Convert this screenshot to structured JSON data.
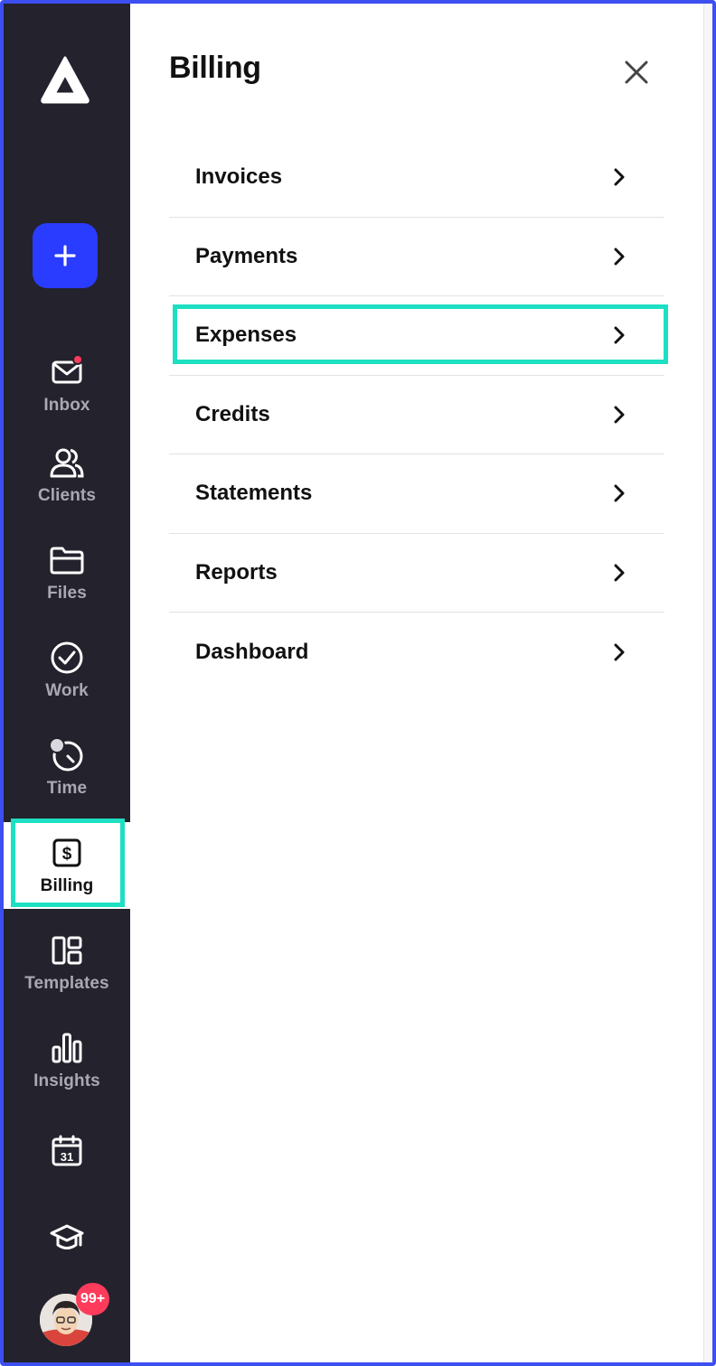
{
  "sidebar": {
    "logo_icon": "app-logo-triangle",
    "add_icon": "plus-icon",
    "items": [
      {
        "id": "inbox",
        "label": "Inbox",
        "icon": "mail-icon",
        "has_dot": true
      },
      {
        "id": "clients",
        "label": "Clients",
        "icon": "users-icon"
      },
      {
        "id": "files",
        "label": "Files",
        "icon": "folder-icon"
      },
      {
        "id": "work",
        "label": "Work",
        "icon": "check-circle-icon"
      },
      {
        "id": "time",
        "label": "Time",
        "icon": "timer-icon"
      },
      {
        "id": "billing",
        "label": "Billing",
        "icon": "dollar-icon",
        "active": true
      },
      {
        "id": "templates",
        "label": "Templates",
        "icon": "layout-icon"
      },
      {
        "id": "insights",
        "label": "Insights",
        "icon": "bar-chart-icon"
      },
      {
        "id": "calendar",
        "label": "",
        "icon": "calendar-icon",
        "icon_text": "31"
      },
      {
        "id": "academy",
        "label": "",
        "icon": "graduation-cap-icon"
      }
    ],
    "avatar_badge": "99+"
  },
  "panel": {
    "title": "Billing",
    "close_icon": "close-icon",
    "menu": [
      {
        "label": "Invoices"
      },
      {
        "label": "Payments"
      },
      {
        "label": "Expenses",
        "highlighted": true
      },
      {
        "label": "Credits"
      },
      {
        "label": "Statements"
      },
      {
        "label": "Reports"
      },
      {
        "label": "Dashboard"
      }
    ]
  },
  "colors": {
    "sidebar_bg": "#23222d",
    "accent_blue": "#2a3cff",
    "highlight": "#1ddfc2",
    "notification": "#ff3b5c"
  }
}
